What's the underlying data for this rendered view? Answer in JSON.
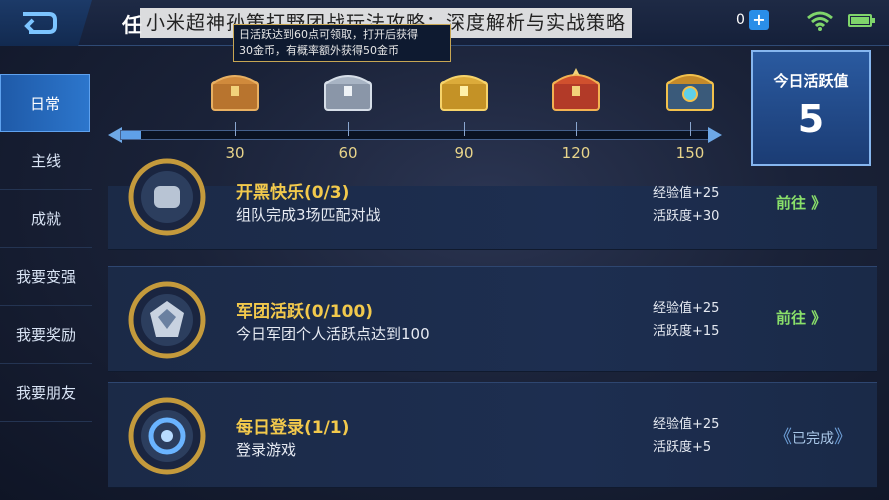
{
  "header": {
    "page_label": "任",
    "overlay_title": "小米超神孙策打野团战玩法攻略：深度解析与实战策略",
    "tooltip_line1": "日活跃达到60点可领取，打开后获得",
    "tooltip_line2": "30金币，有概率额外获得50金币",
    "currency_value": "0"
  },
  "sidebar": {
    "items": [
      {
        "label": "日常",
        "active": true
      },
      {
        "label": "主线",
        "active": false
      },
      {
        "label": "成就",
        "active": false
      },
      {
        "label": "我要变强",
        "active": false
      },
      {
        "label": "我要奖励",
        "active": false
      },
      {
        "label": "我要朋友",
        "active": false
      }
    ]
  },
  "progress": {
    "current": 5,
    "max": 150,
    "milestones": [
      {
        "value": "30",
        "chest": "bronze-chest-icon"
      },
      {
        "value": "60",
        "chest": "silver-chest-icon"
      },
      {
        "value": "90",
        "chest": "gold-chest-icon"
      },
      {
        "value": "120",
        "chest": "red-chest-icon"
      },
      {
        "value": "150",
        "chest": "legend-chest-icon"
      }
    ]
  },
  "today": {
    "label": "今日活跃值",
    "value": "5"
  },
  "tasks": [
    {
      "title": "开黑快乐(0/3)",
      "desc": "组队完成3场匹配对战",
      "exp": "经验值+25",
      "activity": "活跃度+30",
      "action": "前往 》",
      "done": false
    },
    {
      "title": "军团活跃(0/100)",
      "desc": "今日军团个人活跃点达到100",
      "exp": "经验值+25",
      "activity": "活跃度+15",
      "action": "前往 》",
      "done": false
    },
    {
      "title": "每日登录(1/1)",
      "desc": "登录游戏",
      "exp": "经验值+25",
      "activity": "活跃度+5",
      "action": "已完成",
      "done": true
    }
  ],
  "colors": {
    "accent_blue": "#2c76cc",
    "gold_text": "#f2c94c",
    "go_green": "#8ae06a"
  }
}
